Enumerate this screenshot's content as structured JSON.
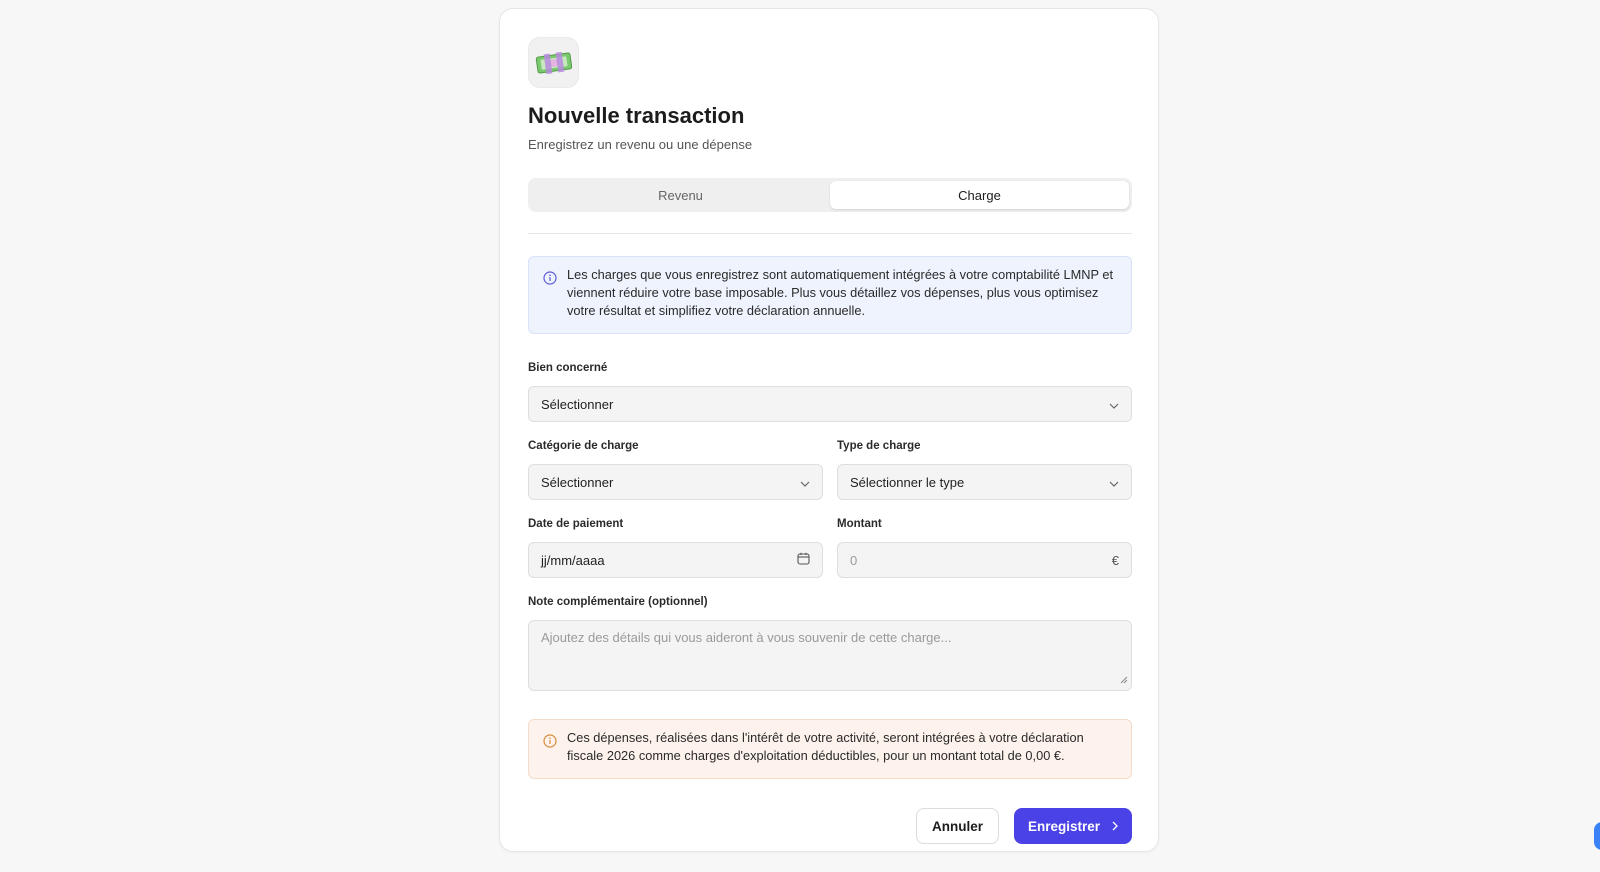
{
  "modal": {
    "icon": "money-bills-icon",
    "title": "Nouvelle transaction",
    "subtitle": "Enregistrez un revenu ou une dépense"
  },
  "tabs": [
    {
      "label": "Revenu",
      "active": false
    },
    {
      "label": "Charge",
      "active": true
    }
  ],
  "info": {
    "icon": "info-circle-icon",
    "text": "Les charges que vous enregistrez sont automatiquement intégrées à votre comptabilité LMNP et viennent réduire votre base imposable. Plus vous détaillez vos dépenses, plus vous optimisez votre résultat et simplifiez votre déclaration annuelle."
  },
  "form": {
    "bien": {
      "label": "Bien concerné",
      "value": "Sélectionner"
    },
    "categorie": {
      "label": "Catégorie de charge",
      "value": "Sélectionner"
    },
    "type": {
      "label": "Type de charge",
      "value": "Sélectionner le type"
    },
    "date": {
      "label": "Date de paiement",
      "value": "jj/mm/aaaa"
    },
    "montant": {
      "label": "Montant",
      "placeholder": "0",
      "currency": "€"
    },
    "note": {
      "label": "Note complémentaire (optionnel)",
      "placeholder": "Ajoutez des détails qui vous aideront à vous souvenir de cette charge..."
    }
  },
  "warning": {
    "icon": "info-circle-icon",
    "text": "Ces dépenses, réalisées dans l'intérêt de votre activité, seront intégrées à votre déclaration fiscale 2026 comme charges d'exploitation déductibles, pour un montant total de 0,00 €."
  },
  "actions": {
    "cancel_label": "Annuler",
    "save_label": "Enregistrer"
  },
  "colors": {
    "accent": "#4a42e6",
    "info_bg": "#eef3fd",
    "warn_bg": "#fdf3ec"
  }
}
